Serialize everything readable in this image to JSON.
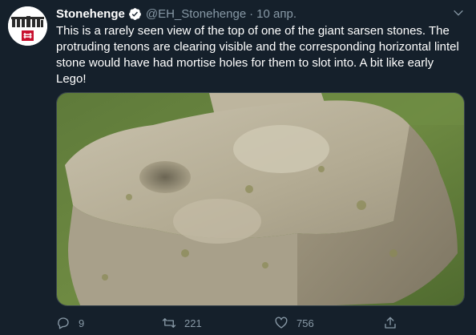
{
  "tweet": {
    "display_name": "Stonehenge",
    "handle": "@EH_Stonehenge",
    "separator": "·",
    "date": "10 апр.",
    "text": "This is a rarely seen view of the top of one of the giant sarsen stones. The protruding tenons are clearing visible and the corresponding horizontal lintel stone would have had mortise holes for them to slot into. A bit like early Lego!",
    "avatar_icon": "stonehenge-logo",
    "media_description_icon": "photo",
    "colors": {
      "background": "#15202b",
      "text": "#ffffff",
      "muted": "#8899a6",
      "verified": "#ffffff",
      "avatar_accent": "#c8102e"
    }
  },
  "actions": {
    "reply_count": "9",
    "retweet_count": "221",
    "like_count": "756"
  }
}
